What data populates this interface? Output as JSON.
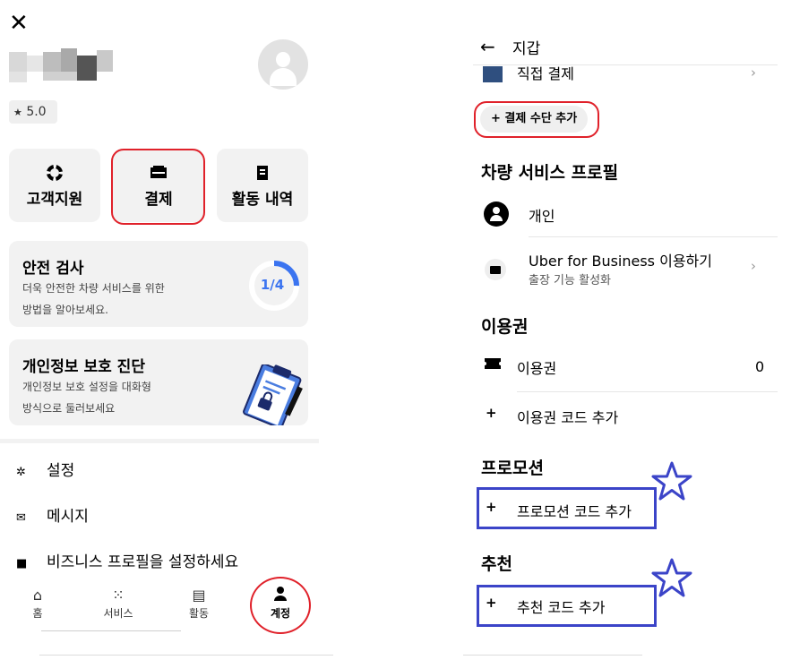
{
  "left": {
    "close_icon": "✕",
    "rating": {
      "star": "★",
      "value": "5.0"
    },
    "tiles": {
      "support": {
        "icon": "life-ring-icon",
        "label": "고객지원"
      },
      "payment": {
        "icon": "wallet-icon",
        "label": "결제"
      },
      "activity": {
        "icon": "receipt-icon",
        "label": "활동 내역"
      }
    },
    "safety_card": {
      "title": "안전 검사",
      "desc_line1": "더욱 안전한 차량 서비스를 위한",
      "desc_line2": "방법을 알아보세요.",
      "progress_label": "1/4",
      "progress_fraction": 0.25
    },
    "privacy_card": {
      "title": "개인정보 보호 진단",
      "desc_line1": "개인정보 보호 설정을 대화형",
      "desc_line2": "방식으로 둘러보세요"
    },
    "menu": {
      "settings": {
        "icon": "gear-icon",
        "label": "설정"
      },
      "messages": {
        "icon": "envelope-icon",
        "label": "메시지"
      },
      "business": {
        "icon": "briefcase-icon",
        "label": "비즈니스 프로필을 설정하세요"
      }
    },
    "nav": {
      "home": {
        "icon": "home-icon",
        "label": "홈"
      },
      "services": {
        "icon": "grid-icon",
        "label": "서비스"
      },
      "activity": {
        "icon": "receipt-icon",
        "label": "활동"
      },
      "account": {
        "icon": "person-icon",
        "label": "계정"
      }
    }
  },
  "right": {
    "header": {
      "back_icon": "←",
      "title": "지갑"
    },
    "direct_pay": {
      "label": "직접 결제",
      "chevron": "›"
    },
    "add_payment_method": "+ 결제 수단 추가",
    "profile_section": {
      "title": "차량 서비스 프로필",
      "personal": "개인",
      "business_title": "Uber for Business 이용하기",
      "business_sub": "출장 기능 활성화",
      "chevron": "›"
    },
    "voucher_section": {
      "title": "이용권",
      "voucher_label": "이용권",
      "voucher_count": "0",
      "add_icon": "+",
      "add_label": "이용권 코드 추가"
    },
    "promo_section": {
      "title": "프로모션",
      "add_icon": "+",
      "add_label": "프로모션 코드 추가"
    },
    "referral_section": {
      "title": "추천",
      "add_icon": "+",
      "add_label": "추천 코드 추가"
    }
  },
  "colors": {
    "annotation_red": "#e0212a",
    "annotation_blue": "#3b44c8",
    "progress_blue": "#3b74f0",
    "card_bg": "#f2f2f2"
  }
}
